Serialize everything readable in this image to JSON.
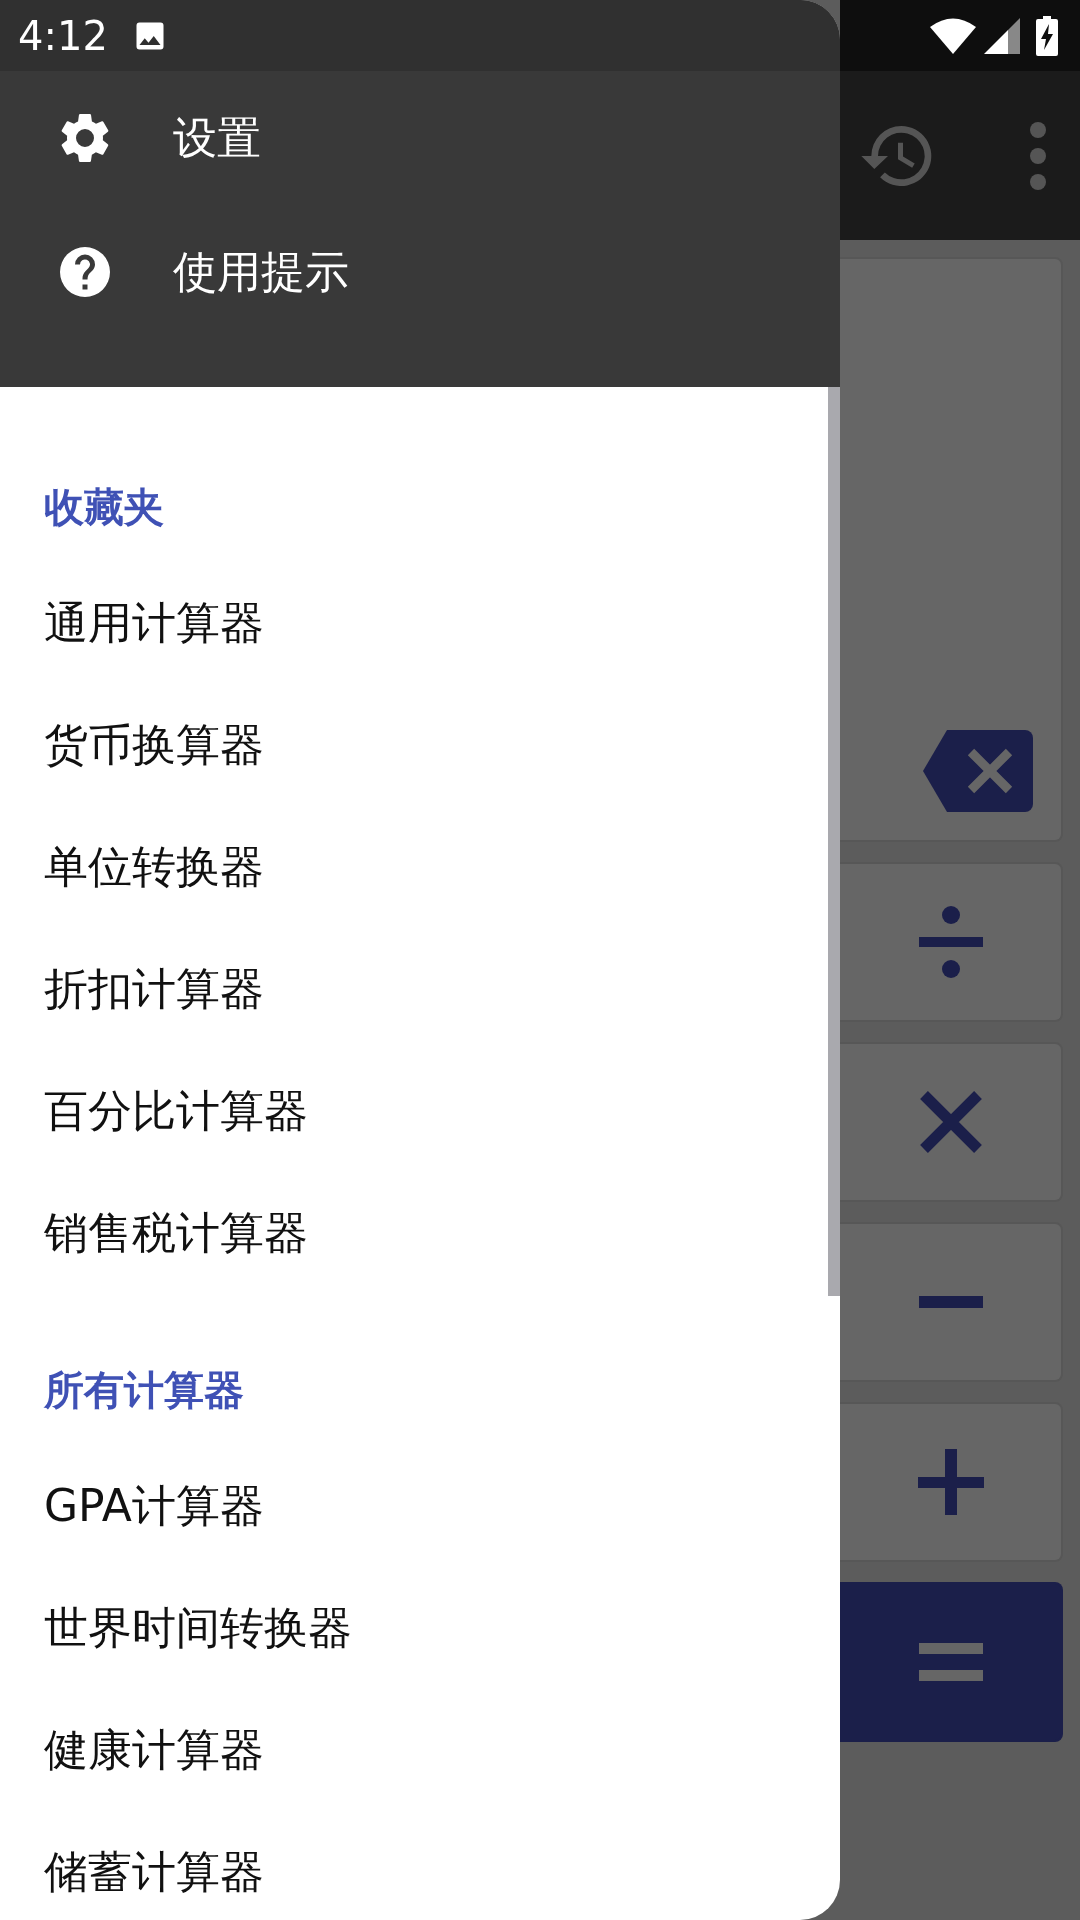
{
  "status_bar": {
    "time": "4:12"
  },
  "drawer": {
    "header_items": [
      {
        "kind": "settings",
        "label": "设置"
      },
      {
        "kind": "help",
        "label": "使用提示"
      }
    ],
    "sections": [
      {
        "title": "收藏夹",
        "items": [
          "通用计算器",
          "货币换算器",
          "单位转换器",
          "折扣计算器",
          "百分比计算器",
          "销售税计算器"
        ]
      },
      {
        "title": "所有计算器",
        "items": [
          "GPA计算器",
          "世界时间转换器",
          "健康计算器",
          "储蓄计算器"
        ]
      }
    ]
  }
}
